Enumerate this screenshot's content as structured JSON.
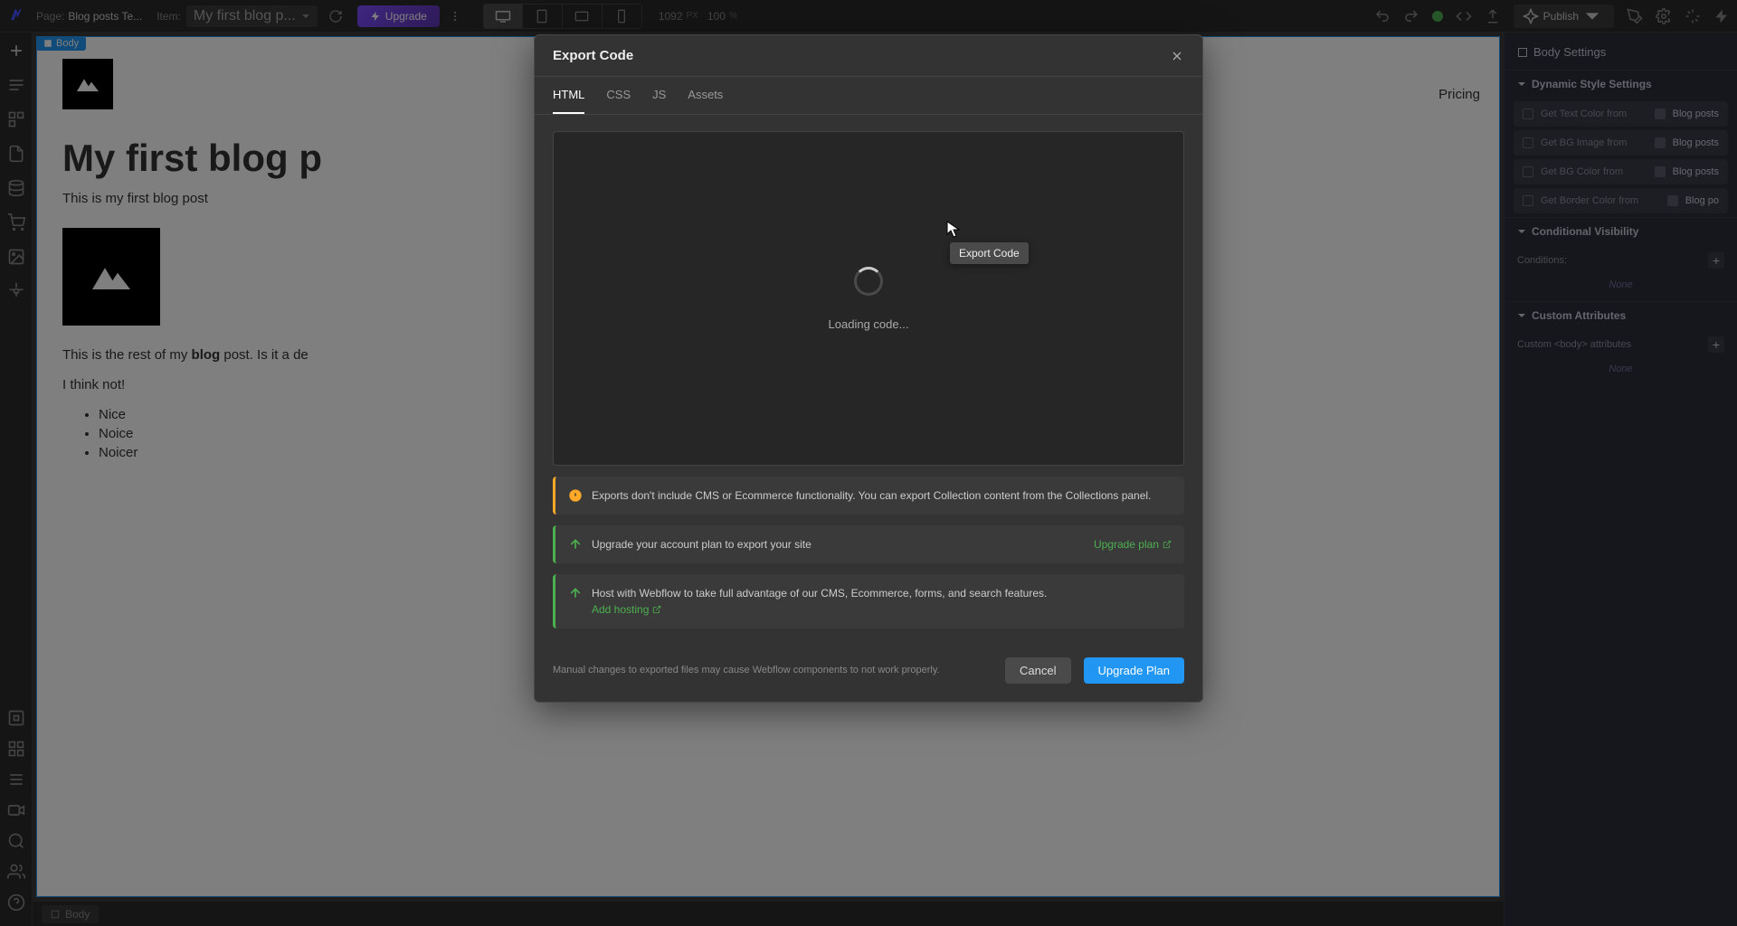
{
  "topbar": {
    "page_prefix": "Page:",
    "page_name": "Blog posts Te...",
    "item_prefix": "Item:",
    "item_name": "My first blog p...",
    "upgrade_label": "Upgrade",
    "width": "1092",
    "px_label": "PX",
    "zoom": "100",
    "pct_label": "%",
    "publish_label": "Publish"
  },
  "canvas": {
    "body_tag": "Body",
    "h1": "My first blog p",
    "sub": "This is my first blog post",
    "rest_pre": "This is the rest of my ",
    "rest_bold": "blog",
    "rest_post": " post. Is it a de",
    "think": "I think not!",
    "li1": "Nice",
    "li2": "Noice",
    "li3": "Noicer",
    "nav_pricing": "Pricing"
  },
  "rightpanel": {
    "title": "Body Settings",
    "section_dynamic": "Dynamic Style Settings",
    "items": [
      {
        "label": "Get Text Color from",
        "source": "Blog posts"
      },
      {
        "label": "Get BG Image from",
        "source": "Blog posts"
      },
      {
        "label": "Get BG Color from",
        "source": "Blog posts"
      },
      {
        "label": "Get Border Color from",
        "source": "Blog po"
      }
    ],
    "section_visibility": "Conditional Visibility",
    "conditions_label": "Conditions:",
    "none1": "None",
    "section_custom": "Custom Attributes",
    "custom_attr_label": "Custom <body> attributes",
    "none2": "None"
  },
  "bottombar": {
    "crumb": "Body"
  },
  "modal": {
    "title": "Export Code",
    "tabs": {
      "html": "HTML",
      "css": "CSS",
      "js": "JS",
      "assets": "Assets"
    },
    "loading": "Loading code...",
    "info_banner": "Exports don't include CMS or Ecommerce functionality. You can export Collection content from the Collections panel.",
    "upgrade_banner1_text": "Upgrade your account plan to export your site",
    "upgrade_banner1_link": "Upgrade plan",
    "upgrade_banner2_text": "Host with Webflow to take full advantage of our CMS, Ecommerce, forms, and search features.",
    "upgrade_banner2_link": "Add hosting",
    "footer_text": "Manual changes to exported files may cause Webflow components to not work properly.",
    "cancel": "Cancel",
    "upgrade_plan": "Upgrade Plan"
  },
  "tooltip": "Export Code"
}
